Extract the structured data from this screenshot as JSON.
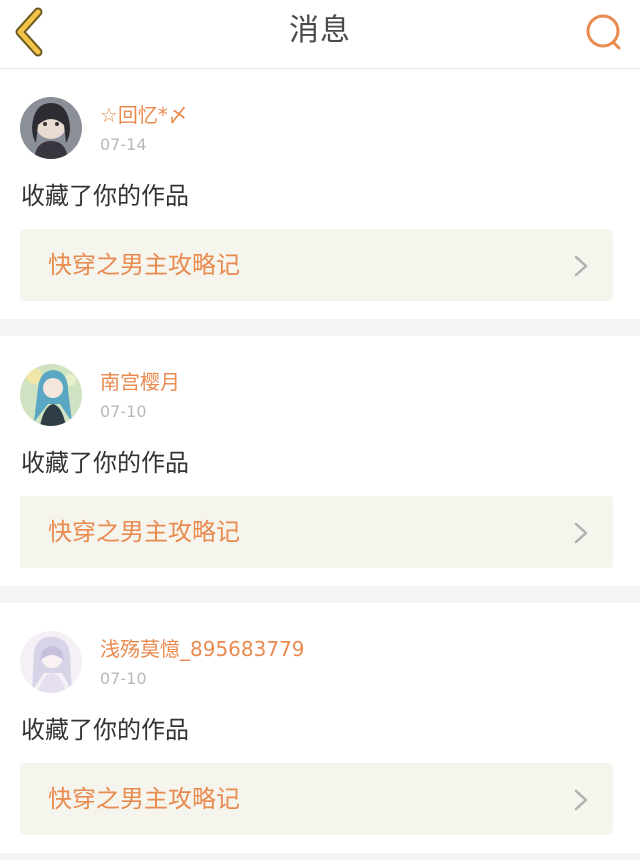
{
  "header": {
    "title": "消息",
    "back_icon": "chevron-left-icon",
    "search_icon": "search-icon"
  },
  "colors": {
    "accent": "#e98a4f",
    "back_icon_fill": "#f2c44a",
    "back_icon_stroke": "#6d5a20",
    "date_gray": "#b8b8b8",
    "link_bg": "#f5f5ee",
    "page_bg": "#f4f4f4"
  },
  "messages": [
    {
      "username": "☆回忆*〆",
      "date": "07-14",
      "action": "收藏了你的作品",
      "work_title": "快穿之男主攻略记"
    },
    {
      "username": "南宫樱月",
      "date": "07-10",
      "action": "收藏了你的作品",
      "work_title": "快穿之男主攻略记"
    },
    {
      "username": "浅殇莫憶_895683779",
      "date": "07-10",
      "action": "收藏了你的作品",
      "work_title": "快穿之男主攻略记"
    }
  ]
}
